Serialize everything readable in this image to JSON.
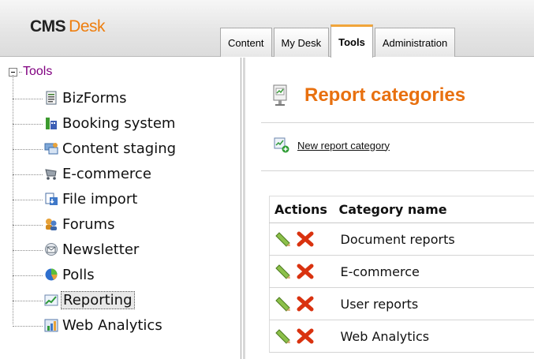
{
  "header": {
    "logo_primary": "CMS",
    "logo_secondary": "Desk",
    "tabs": [
      {
        "label": "Content",
        "active": false
      },
      {
        "label": "My Desk",
        "active": false
      },
      {
        "label": "Tools",
        "active": true
      },
      {
        "label": "Administration",
        "active": false
      }
    ]
  },
  "tree": {
    "root": "Tools",
    "items": [
      {
        "label": "BizForms",
        "icon": "bizforms-icon"
      },
      {
        "label": "Booking system",
        "icon": "booking-system-icon"
      },
      {
        "label": "Content staging",
        "icon": "content-staging-icon"
      },
      {
        "label": "E-commerce",
        "icon": "ecommerce-icon"
      },
      {
        "label": "File import",
        "icon": "file-import-icon"
      },
      {
        "label": "Forums",
        "icon": "forums-icon"
      },
      {
        "label": "Newsletter",
        "icon": "newsletter-icon"
      },
      {
        "label": "Polls",
        "icon": "polls-icon"
      },
      {
        "label": "Reporting",
        "icon": "reporting-icon",
        "selected": true
      },
      {
        "label": "Web Analytics",
        "icon": "web-analytics-icon"
      }
    ]
  },
  "main": {
    "title": "Report categories",
    "title_icon": "report-categories-icon",
    "new_link": "New report category",
    "new_icon": "new-report-category-icon",
    "grid": {
      "columns": [
        "Actions",
        "Category name"
      ],
      "rows": [
        {
          "name": "Document reports"
        },
        {
          "name": "E-commerce"
        },
        {
          "name": "User reports"
        },
        {
          "name": "Web Analytics"
        }
      ],
      "edit_icon": "edit-pencil-icon",
      "delete_icon": "delete-x-icon"
    }
  },
  "colors": {
    "accent_orange": "#e8700f",
    "active_tab_border": "#f1a53a",
    "root_purple": "#800080"
  }
}
